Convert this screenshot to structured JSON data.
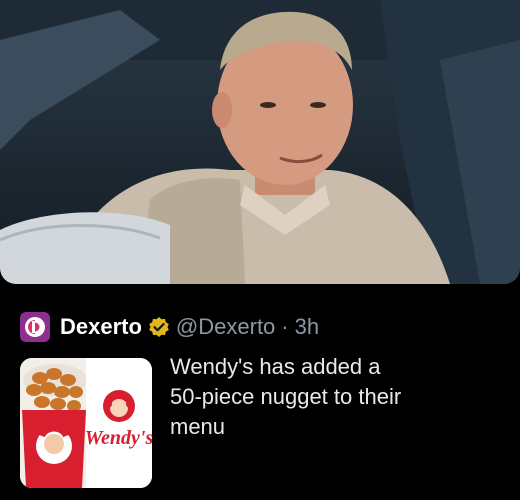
{
  "photo": {
    "description_icon": "man-in-car-photo"
  },
  "tweet": {
    "display_name": "Dexerto",
    "verified_icon": "verified-badge-icon",
    "handle": "@Dexerto",
    "separator": "·",
    "time": "3h",
    "text_lines": [
      "Wendy's has added a",
      "50-piece nugget to their",
      "menu"
    ],
    "thumbnail_logo_text": "Wendy's"
  },
  "colors": {
    "background": "#000000",
    "verified_gold": "#e2b719",
    "muted_text": "#8b98a5",
    "wendys_red": "#d71f30"
  }
}
